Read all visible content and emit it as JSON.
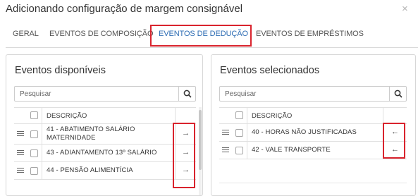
{
  "dialog": {
    "title": "Adicionando configuração de margem consignável",
    "close_glyph": "×"
  },
  "tabs": [
    {
      "label": "GERAL",
      "active": false
    },
    {
      "label": "EVENTOS DE COMPOSIÇÃO",
      "active": false
    },
    {
      "label": "EVENTOS DE DEDUÇÃO",
      "active": true
    },
    {
      "label": "EVENTOS DE EMPRÉSTIMOS",
      "active": false
    }
  ],
  "available": {
    "title": "Eventos disponíveis",
    "search_placeholder": "Pesquisar",
    "column_header": "DESCRIÇÃO",
    "items": [
      {
        "label": "41 - ABATIMENTO SALÁRIO MATERNIDADE",
        "action_icon": "arrow-right-icon",
        "action_glyph": "→"
      },
      {
        "label": "43 - ADIANTAMENTO 13º SALÁRIO",
        "action_icon": "arrow-right-icon",
        "action_glyph": "→"
      },
      {
        "label": "44 - PENSÃO ALIMENTÍCIA",
        "action_icon": "arrow-right-icon",
        "action_glyph": "→"
      }
    ]
  },
  "selected": {
    "title": "Eventos selecionados",
    "search_placeholder": "Pesquisar",
    "column_header": "DESCRIÇÃO",
    "items": [
      {
        "label": "40 - HORAS NÃO JUSTIFICADAS",
        "action_icon": "arrow-left-icon",
        "action_glyph": "←"
      },
      {
        "label": "42 - VALE TRANSPORTE",
        "action_icon": "arrow-left-icon",
        "action_glyph": "←"
      }
    ]
  },
  "colors": {
    "accent": "#2e6db4",
    "highlight": "#d9232d",
    "border": "#d7d7d7"
  }
}
